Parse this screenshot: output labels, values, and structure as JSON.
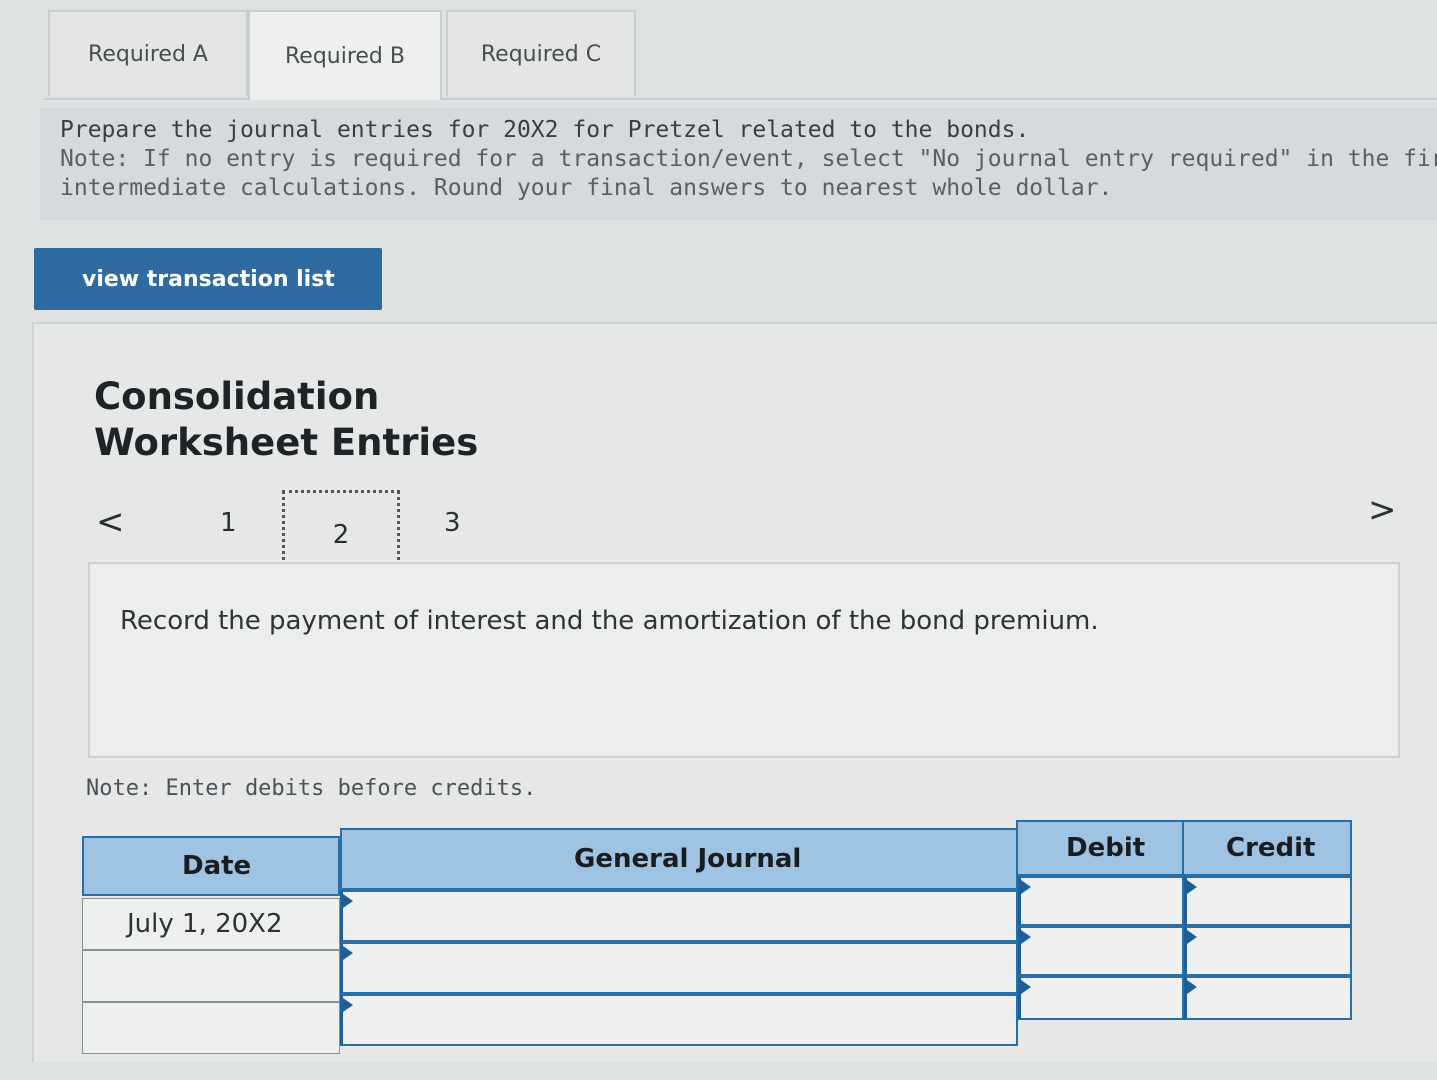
{
  "tabs": [
    {
      "label": "Required A",
      "active": false
    },
    {
      "label": "Required B",
      "active": true
    },
    {
      "label": "Required C",
      "active": false
    }
  ],
  "instructions": {
    "line1": "Prepare the journal entries for 20X2 for Pretzel related to the bonds.",
    "line2": "Note: If no entry is required for a transaction/event, select \"No journal entry required\" in the first acc",
    "line3": "intermediate calculations. Round your final answers to nearest whole dollar."
  },
  "view_button": "view transaction list",
  "worksheet": {
    "title_line1": "Consolidation",
    "title_line2": "Worksheet Entries",
    "pages": [
      "1",
      "2",
      "3"
    ],
    "current_page": "2",
    "prev_icon": "chevron-left-icon",
    "next_icon": "chevron-right-icon",
    "prev_glyph": "<",
    "next_glyph": ">"
  },
  "record_text": "Record the payment of interest and the amortization of the bond premium.",
  "note_text": "Note: Enter debits before credits.",
  "journal": {
    "headers": {
      "date": "Date",
      "general_journal": "General Journal",
      "debit": "Debit",
      "credit": "Credit"
    },
    "rows": [
      {
        "date": "July 1, 20X2",
        "account": "",
        "debit": "",
        "credit": ""
      },
      {
        "date": "",
        "account": "",
        "debit": "",
        "credit": ""
      },
      {
        "date": "",
        "account": "",
        "debit": "",
        "credit": ""
      }
    ]
  },
  "colors": {
    "accent": "#2f6ba0",
    "header_bg": "#9ec3e3",
    "table_border": "#2a6ea8"
  }
}
